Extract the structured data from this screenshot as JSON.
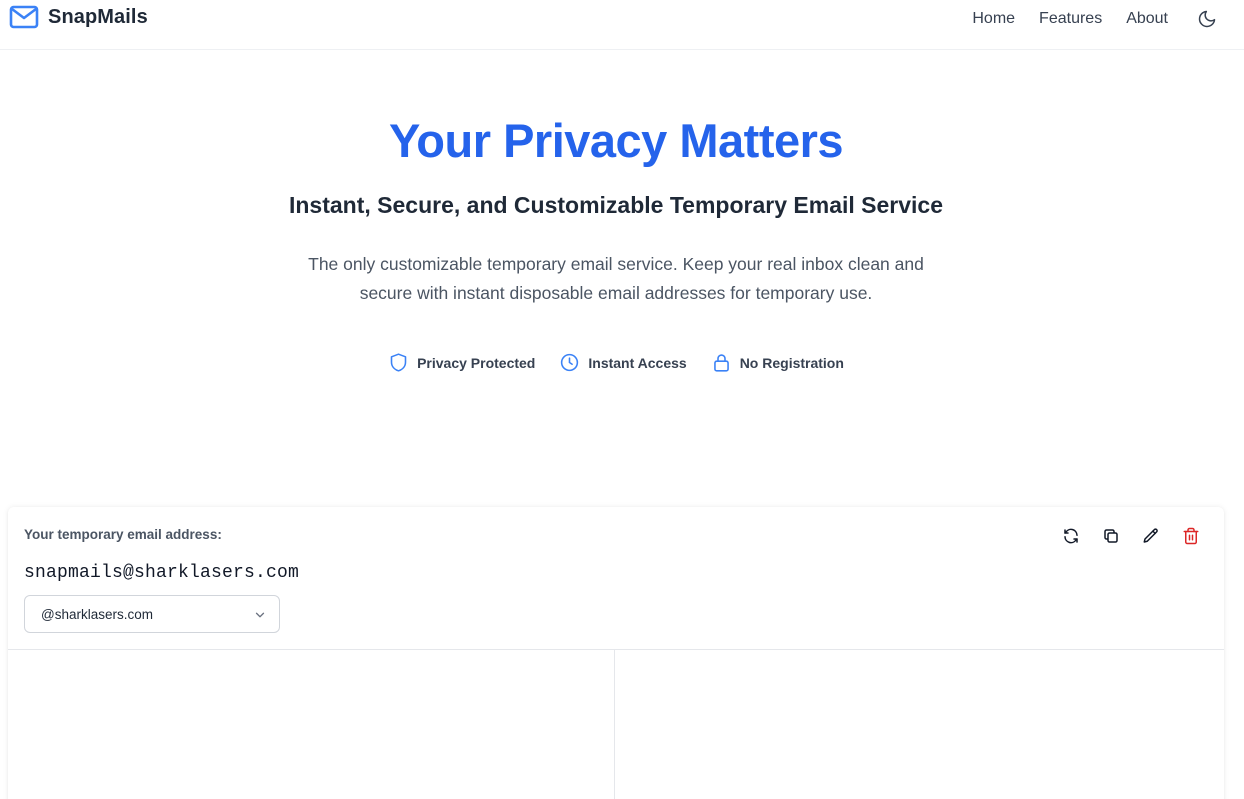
{
  "navbar": {
    "brand": "SnapMails",
    "brand_icon": "mail-icon",
    "links": [
      "Home",
      "Features",
      "About"
    ],
    "theme_icon": "moon-icon"
  },
  "hero": {
    "title": "Your Privacy Matters",
    "subtitle": "Instant, Secure, and Customizable Temporary Email Service",
    "description": "The only customizable temporary email service. Keep your real inbox clean and secure with instant disposable email addresses for temporary use.",
    "features": [
      {
        "icon": "shield-icon",
        "label": "Privacy Protected"
      },
      {
        "icon": "clock-icon",
        "label": "Instant Access"
      },
      {
        "icon": "lock-icon",
        "label": "No Registration"
      }
    ]
  },
  "email_card": {
    "label": "Your temporary email address:",
    "address": "snapmails@sharklasers.com",
    "domain_selected": "@sharklasers.com",
    "actions": [
      "refresh-icon",
      "copy-icon",
      "edit-icon",
      "trash-icon"
    ]
  },
  "colors": {
    "accent": "#2563eb",
    "icon_blue": "#3b82f6",
    "danger": "#dc2626",
    "text_dark": "#1f2937",
    "text_muted": "#4b5563",
    "border": "#e5e7eb"
  }
}
